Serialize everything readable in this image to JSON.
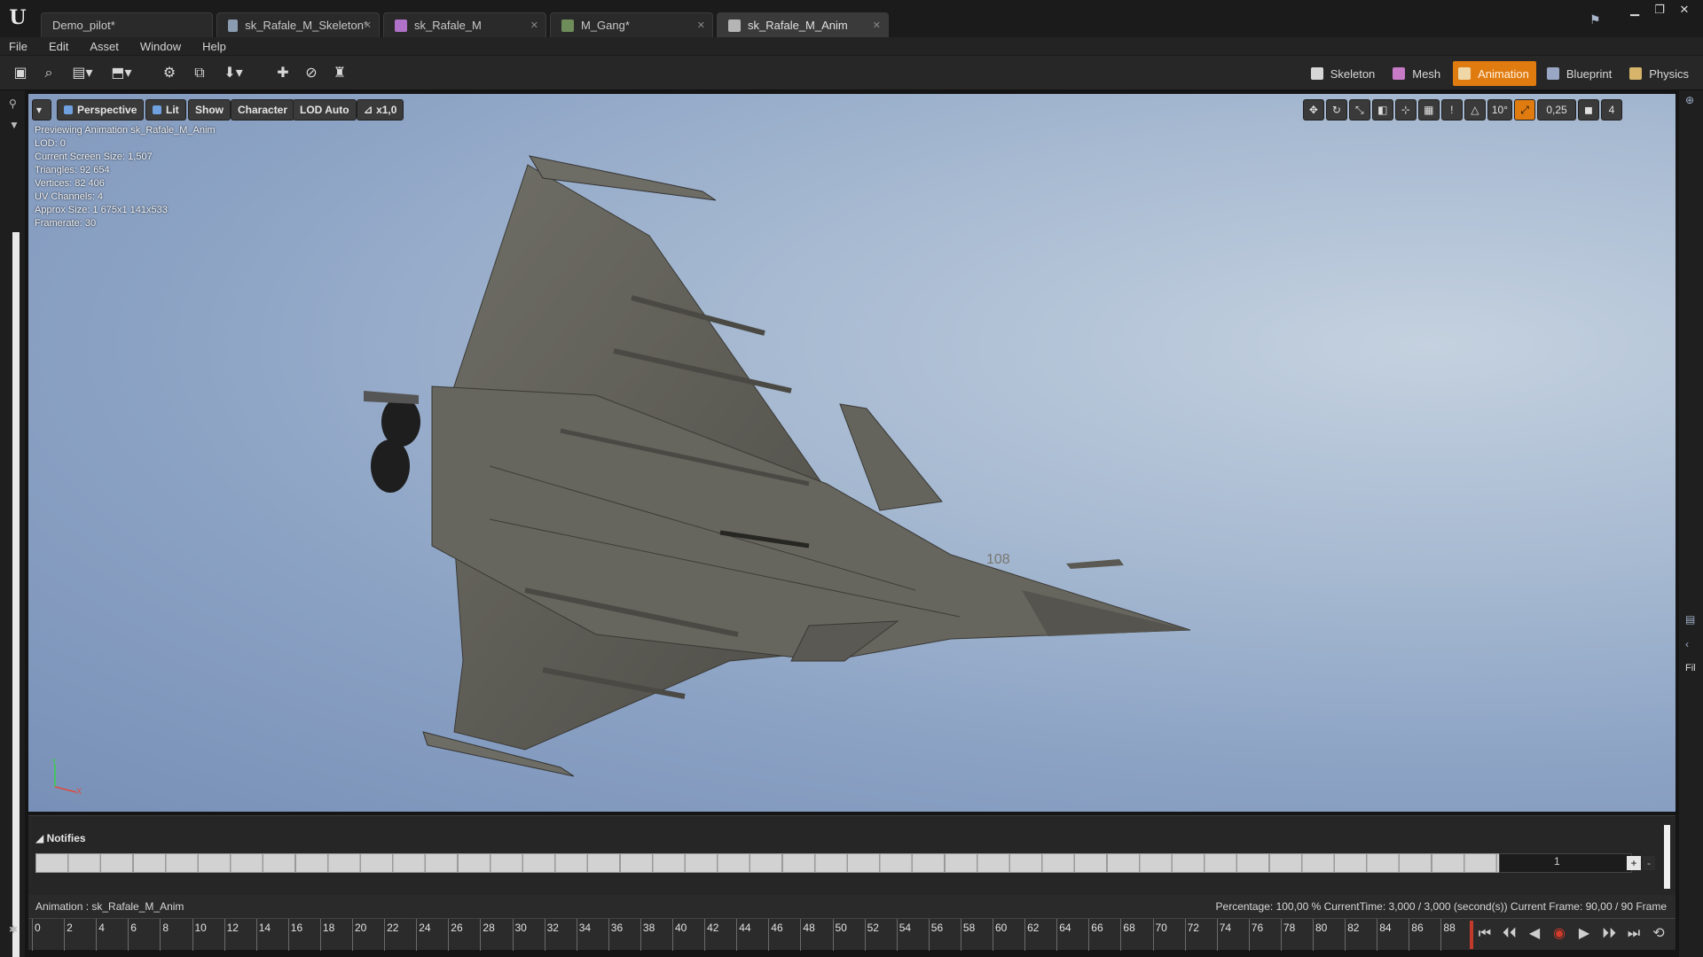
{
  "tabs": [
    {
      "label": "Demo_pilot*",
      "active": false
    },
    {
      "label": "sk_Rafale_M_Skeleton*",
      "active": false
    },
    {
      "label": "sk_Rafale_M",
      "active": false
    },
    {
      "label": "M_Gang*",
      "active": false
    },
    {
      "label": "sk_Rafale_M_Anim",
      "active": true
    }
  ],
  "menu": [
    "File",
    "Edit",
    "Asset",
    "Window",
    "Help"
  ],
  "modes": [
    {
      "label": "Skeleton",
      "active": false,
      "icon_color": "#d6d6d6"
    },
    {
      "label": "Mesh",
      "active": false,
      "icon_color": "#c77bc7"
    },
    {
      "label": "Animation",
      "active": true,
      "icon_color": "#f0d7a8"
    },
    {
      "label": "Blueprint",
      "active": false,
      "icon_color": "#9aa7c4"
    },
    {
      "label": "Physics",
      "active": false,
      "icon_color": "#d6b56a"
    }
  ],
  "viewport": {
    "buttons": [
      "Perspective",
      "Lit",
      "Show",
      "Character",
      "LOD Auto",
      "x1,0"
    ],
    "info": [
      "Previewing Animation sk_Rafale_M_Anim",
      "LOD: 0",
      "Current Screen Size: 1,507",
      "Triangles: 92 654",
      "Vertices: 82 406",
      "UV Channels: 4",
      "Approx Size: 1 675x1 141x533",
      "Framerate: 30"
    ],
    "snap_angle": "10°",
    "snap_scale": "0,25",
    "camera_speed": "4",
    "tail_number": "108",
    "axis_x": "X",
    "axis_y": "Y"
  },
  "notifies": {
    "header": "Notifies",
    "track_index": "1",
    "plus": "+",
    "minus": "-"
  },
  "status": {
    "left": "Animation :  sk_Rafale_M_Anim",
    "right": "Percentage:  100,00 % CurrentTime:  3,000 / 3,000 (second(s)) Current Frame:  90,00 / 90 Frame"
  },
  "timeline": {
    "ticks": [
      "0",
      "2",
      "4",
      "6",
      "8",
      "10",
      "12",
      "14",
      "16",
      "18",
      "20",
      "22",
      "24",
      "26",
      "28",
      "30",
      "32",
      "34",
      "36",
      "38",
      "40",
      "42",
      "44",
      "46",
      "48",
      "50",
      "52",
      "54",
      "56",
      "58",
      "60",
      "62",
      "64",
      "66",
      "68",
      "70",
      "72",
      "74",
      "76",
      "78",
      "80",
      "82",
      "84",
      "86",
      "88"
    ]
  },
  "colors": {
    "accent": "#e07b10",
    "sky_top": "#7890b7",
    "sky_bright": "#c4d1df",
    "aircraft": "#5e5d56"
  }
}
